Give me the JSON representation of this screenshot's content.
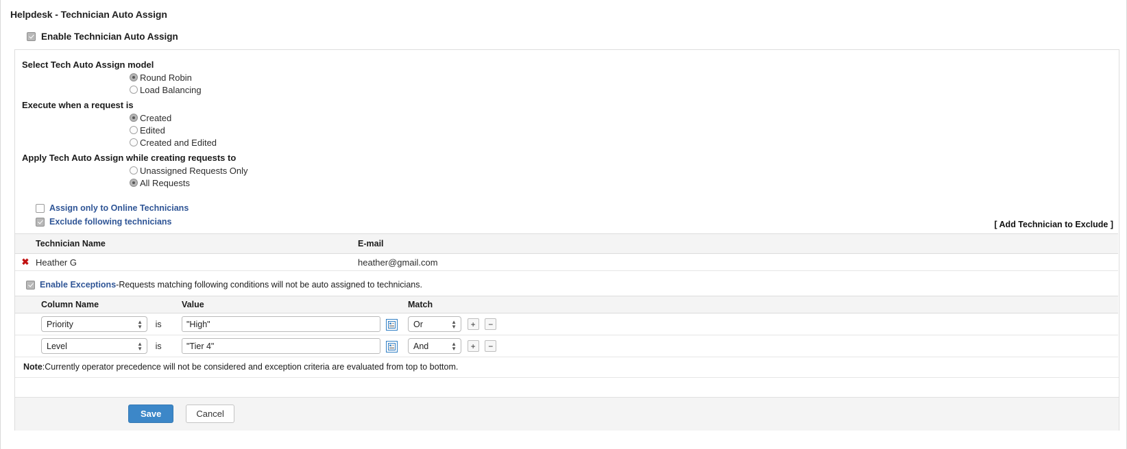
{
  "page": {
    "title": "Helpdesk - Technician Auto Assign"
  },
  "enable": {
    "label": "Enable Technician Auto Assign",
    "checked": true
  },
  "groups": {
    "model": {
      "label": "Select Tech Auto Assign model",
      "options": [
        {
          "label": "Round Robin",
          "selected": true
        },
        {
          "label": "Load Balancing",
          "selected": false
        }
      ]
    },
    "execute": {
      "label": "Execute when a request is",
      "options": [
        {
          "label": "Created",
          "selected": true
        },
        {
          "label": "Edited",
          "selected": false
        },
        {
          "label": "Created and Edited",
          "selected": false
        }
      ]
    },
    "apply": {
      "label": "Apply Tech Auto Assign while creating requests to",
      "options": [
        {
          "label": "Unassigned Requests Only",
          "selected": false
        },
        {
          "label": "All Requests",
          "selected": true
        }
      ]
    }
  },
  "online_only": {
    "label": "Assign only to Online Technicians",
    "checked": false
  },
  "exclude": {
    "label": "Exclude following technicians",
    "checked": true,
    "add_link": "[  Add Technician to Exclude  ]",
    "columns": [
      "Technician Name",
      "E-mail"
    ],
    "rows": [
      {
        "delete_icon": "✖",
        "name": "Heather G",
        "email": "heather@gmail.com"
      }
    ]
  },
  "exceptions": {
    "label": "Enable Exceptions",
    "description": "-Requests matching following conditions will not be auto assigned to technicians.",
    "checked": true,
    "columns": [
      "Column Name",
      "Value",
      "Match"
    ],
    "is_word": "is",
    "add_symbol": "+",
    "remove_symbol": "−",
    "column_options": [
      "Priority",
      "Level"
    ],
    "match_options": [
      "Or",
      "And"
    ],
    "rows": [
      {
        "column": "Priority",
        "value": "\"High\"",
        "match": "Or"
      },
      {
        "column": "Level",
        "value": "\"Tier 4\"",
        "match": "And"
      }
    ],
    "note_label": "Note",
    "note_text": ":Currently operator precedence will not be considered and exception criteria are evaluated from top to bottom."
  },
  "footer": {
    "save_label": "Save",
    "cancel_label": "Cancel"
  },
  "colors": {
    "link_blue": "#2f5596",
    "save_blue": "#3c87c8",
    "delete_red": "#c11111",
    "header_bg": "#f4f4f4"
  }
}
